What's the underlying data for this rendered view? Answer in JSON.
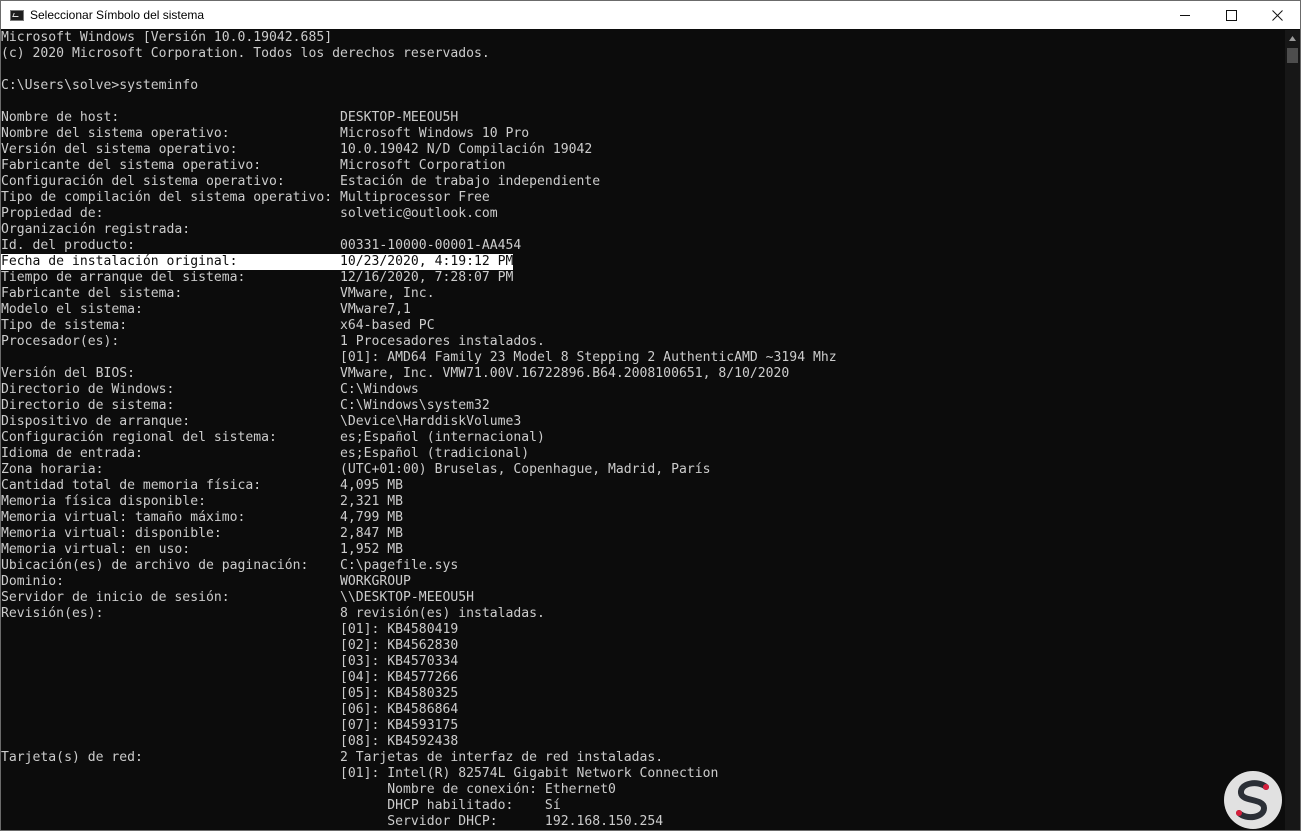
{
  "window": {
    "title": "Seleccionar Símbolo del sistema",
    "minimize_label": "minimize",
    "maximize_label": "maximize",
    "close_label": "close"
  },
  "console": {
    "highlighted_line": 16,
    "lines": [
      "Microsoft Windows [Versión 10.0.19042.685]",
      "(c) 2020 Microsoft Corporation. Todos los derechos reservados.",
      "",
      "C:\\Users\\solve>systeminfo",
      "",
      "Nombre de host:                            DESKTOP-MEEOU5H",
      "Nombre del sistema operativo:              Microsoft Windows 10 Pro",
      "Versión del sistema operativo:             10.0.19042 N/D Compilación 19042",
      "Fabricante del sistema operativo:          Microsoft Corporation",
      "Configuración del sistema operativo:       Estación de trabajo independiente",
      "Tipo de compilación del sistema operativo: Multiprocessor Free",
      "Propiedad de:                              solvetic@outlook.com",
      "Organización registrada:",
      "Id. del producto:                          00331-10000-00001-AA454",
      "Fecha de instalación original:             10/23/2020, 4:19:12 PM",
      "Tiempo de arranque del sistema:            12/16/2020, 7:28:07 PM",
      "Fabricante del sistema:                    VMware, Inc.",
      "Modelo el sistema:                         VMware7,1",
      "Tipo de sistema:                           x64-based PC",
      "Procesador(es):                            1 Procesadores instalados.",
      "                                           [01]: AMD64 Family 23 Model 8 Stepping 2 AuthenticAMD ~3194 Mhz",
      "Versión del BIOS:                          VMware, Inc. VMW71.00V.16722896.B64.2008100651, 8/10/2020",
      "Directorio de Windows:                     C:\\Windows",
      "Directorio de sistema:                     C:\\Windows\\system32",
      "Dispositivo de arranque:                   \\Device\\HarddiskVolume3",
      "Configuración regional del sistema:        es;Español (internacional)",
      "Idioma de entrada:                         es;Español (tradicional)",
      "Zona horaria:                              (UTC+01:00) Bruselas, Copenhague, Madrid, París",
      "Cantidad total de memoria física:          4,095 MB",
      "Memoria física disponible:                 2,321 MB",
      "Memoria virtual: tamaño máximo:            4,799 MB",
      "Memoria virtual: disponible:               2,847 MB",
      "Memoria virtual: en uso:                   1,952 MB",
      "Ubicación(es) de archivo de paginación:    C:\\pagefile.sys",
      "Dominio:                                   WORKGROUP",
      "Servidor de inicio de sesión:              \\\\DESKTOP-MEEOU5H",
      "Revisión(es):                              8 revisión(es) instaladas.",
      "                                           [01]: KB4580419",
      "                                           [02]: KB4562830",
      "                                           [03]: KB4570334",
      "                                           [04]: KB4577266",
      "                                           [05]: KB4580325",
      "                                           [06]: KB4586864",
      "                                           [07]: KB4593175",
      "                                           [08]: KB4592438",
      "Tarjeta(s) de red:                         2 Tarjetas de interfaz de red instaladas.",
      "                                           [01]: Intel(R) 82574L Gigabit Network Connection",
      "                                                 Nombre de conexión: Ethernet0",
      "                                                 DHCP habilitado:    Sí",
      "                                                 Servidor DHCP:      192.168.150.254"
    ]
  },
  "watermark": {
    "icon": "solvetic-logo",
    "colors": {
      "dark": "#2b2f36",
      "accent": "#d61f3c"
    }
  }
}
